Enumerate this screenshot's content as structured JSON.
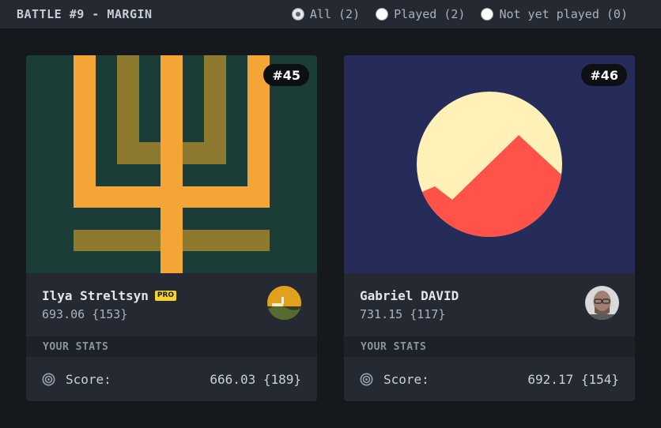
{
  "header": {
    "title": "BATTLE #9 - MARGIN",
    "filters": [
      {
        "label": "All (2)",
        "checked": true
      },
      {
        "label": "Played (2)",
        "checked": false
      },
      {
        "label": "Not yet played (0)",
        "checked": false
      }
    ]
  },
  "cards": [
    {
      "number": "#45",
      "author": "Ilya Streltsyn",
      "pro_label": "PRO",
      "author_score": "693.06 {153}",
      "stats_title": "YOUR STATS",
      "score_label": "Score:",
      "score_value": "666.03 {189}",
      "colors": {
        "background": "#1a3d37",
        "primary": "#f3a536",
        "secondary": "#8e7a2e"
      }
    },
    {
      "number": "#46",
      "author": "Gabriel DAVID",
      "author_score": "731.15 {117}",
      "stats_title": "YOUR STATS",
      "score_label": "Score:",
      "score_value": "692.17 {154}",
      "colors": {
        "background": "#262c5a",
        "primary": "#fff1b8",
        "secondary": "#ff5349"
      }
    }
  ],
  "icons": {
    "score": "target-icon",
    "filter": "radio-icon"
  }
}
